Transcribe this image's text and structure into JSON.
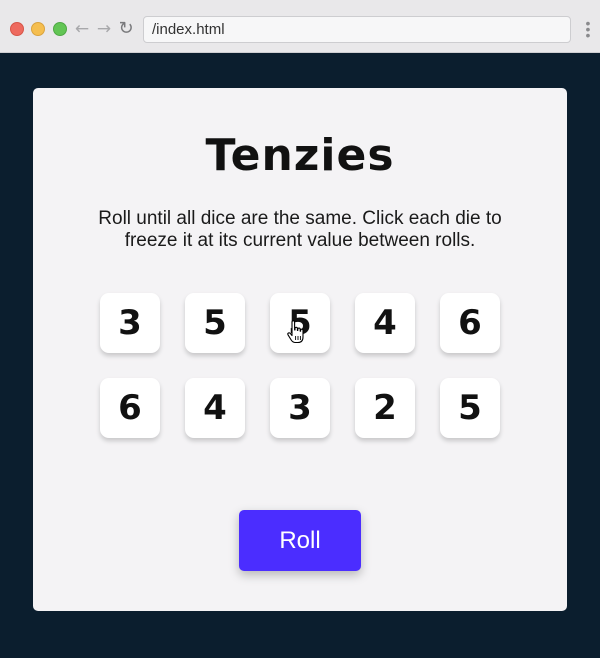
{
  "browser": {
    "url": "/index.html"
  },
  "game": {
    "title": "Tenzies",
    "instructions": "Roll until all dice are the same. Click each die to freeze it at its current value between rolls.",
    "dice": [
      {
        "value": "3"
      },
      {
        "value": "5"
      },
      {
        "value": "5"
      },
      {
        "value": "4"
      },
      {
        "value": "6"
      },
      {
        "value": "6"
      },
      {
        "value": "4"
      },
      {
        "value": "3"
      },
      {
        "value": "2"
      },
      {
        "value": "5"
      }
    ],
    "roll_label": "Roll"
  },
  "colors": {
    "background": "#0b1e2e",
    "card": "#f4f3f5",
    "die": "#ffffff",
    "button": "#4b2dff"
  },
  "icons": [
    "back-arrow-icon",
    "forward-arrow-icon",
    "reload-icon",
    "menu-dots-icon",
    "hand-cursor-icon"
  ]
}
